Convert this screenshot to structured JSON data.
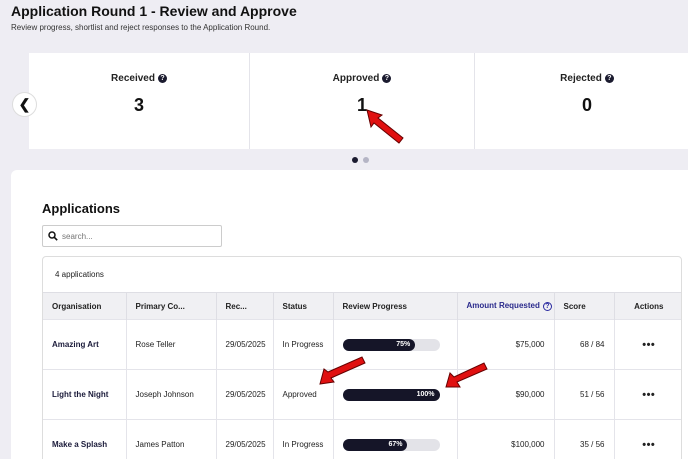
{
  "header": {
    "title": "Application Round 1 - Review and Approve",
    "subtitle": "Review progress, shortlist and reject responses to the Application Round."
  },
  "stats": [
    {
      "label": "Received",
      "value": "3"
    },
    {
      "label": "Approved",
      "value": "1"
    },
    {
      "label": "Rejected",
      "value": "0"
    }
  ],
  "carousel": {
    "prev_glyph": "❮",
    "page_count": 2,
    "active_page": 1
  },
  "applications": {
    "title": "Applications",
    "search_placeholder": "search...",
    "count_text": "4 applications",
    "columns": {
      "organisation": "Organisation",
      "contact": "Primary Co...",
      "received": "Rec...",
      "status": "Status",
      "progress": "Review Progress",
      "amount": "Amount Requested",
      "score": "Score",
      "actions": "Actions"
    },
    "rows": [
      {
        "organisation": "Amazing Art",
        "contact": "Rose Teller",
        "received": "29/05/2025",
        "status": "In Progress",
        "progress": 75,
        "progress_label": "75%",
        "amount": "$75,000",
        "score": "68 / 84",
        "actions": "•••"
      },
      {
        "organisation": "Light the Night",
        "contact": "Joseph Johnson",
        "received": "29/05/2025",
        "status": "Approved",
        "progress": 100,
        "progress_label": "100%",
        "amount": "$90,000",
        "score": "51 / 56",
        "actions": "•••"
      },
      {
        "organisation": "Make a Splash",
        "contact": "James Patton",
        "received": "29/05/2025",
        "status": "In Progress",
        "progress": 67,
        "progress_label": "67%",
        "amount": "$100,000",
        "score": "35 / 56",
        "actions": "•••"
      }
    ]
  },
  "colors": {
    "accent": "#151528",
    "annotation_arrow": "#e01010",
    "background": "#eeedf3"
  }
}
